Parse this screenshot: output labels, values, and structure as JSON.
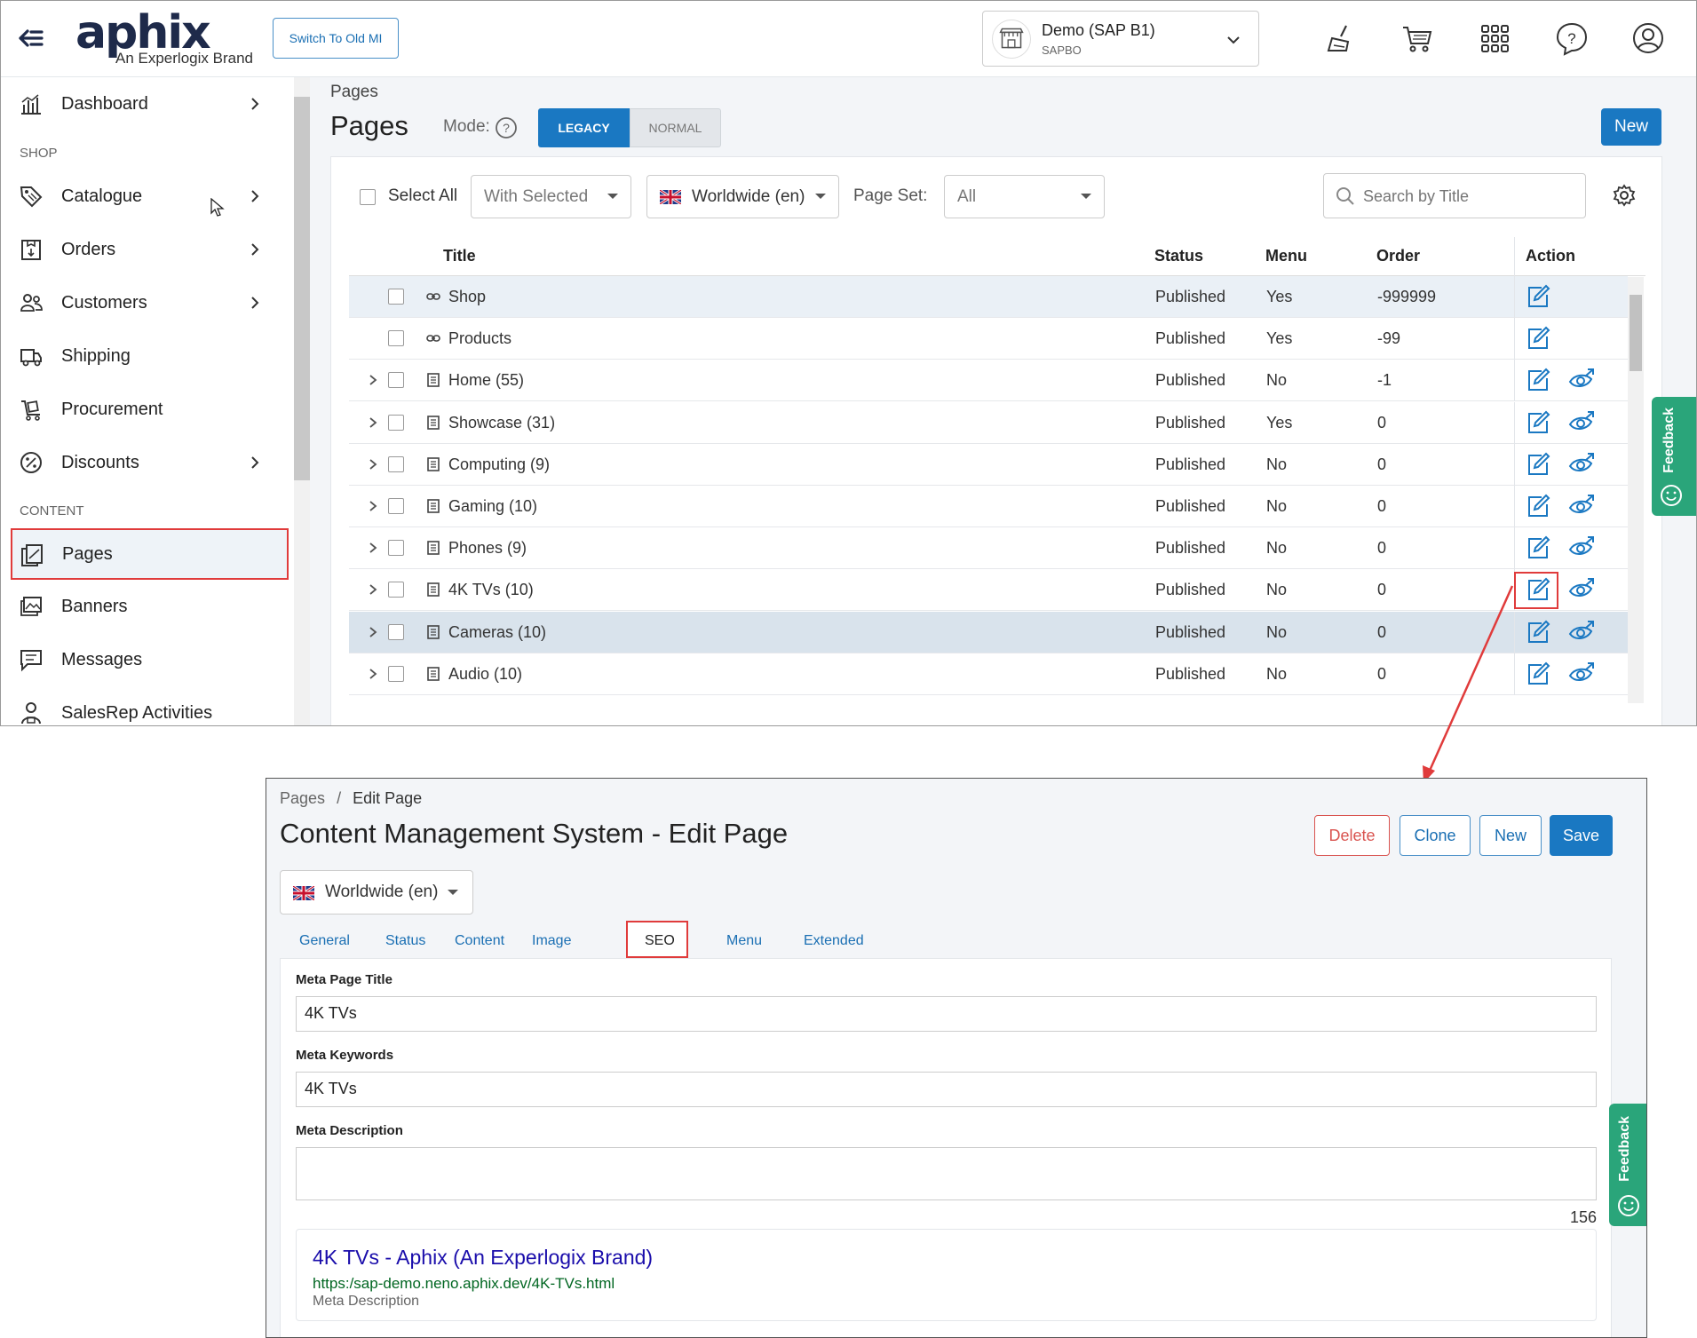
{
  "top": {
    "header": {
      "logo_text": "aphix",
      "logo_subtitle": "An Experlogix Brand",
      "switch_button": "Switch To Old MI",
      "company_name": "Demo (SAP B1)",
      "company_sub": "SAPBO",
      "icons": [
        "back-arrow-icon",
        "broom-icon",
        "cart-icon",
        "apps-grid-icon",
        "help-icon",
        "user-icon"
      ]
    },
    "sidebar": {
      "items": [
        {
          "label": "Dashboard",
          "icon": "dashboard-icon",
          "arrow": true
        },
        {
          "label": "Catalogue",
          "icon": "tag-icon",
          "arrow": true
        },
        {
          "label": "Orders",
          "icon": "orders-icon",
          "arrow": true
        },
        {
          "label": "Customers",
          "icon": "customers-icon",
          "arrow": true
        },
        {
          "label": "Shipping",
          "icon": "truck-icon",
          "arrow": false
        },
        {
          "label": "Procurement",
          "icon": "procurement-icon",
          "arrow": false
        },
        {
          "label": "Discounts",
          "icon": "discount-icon",
          "arrow": true
        },
        {
          "label": "Pages",
          "icon": "pages-icon",
          "arrow": false,
          "active": true
        },
        {
          "label": "Banners",
          "icon": "banners-icon",
          "arrow": false
        },
        {
          "label": "Messages",
          "icon": "messages-icon",
          "arrow": false
        },
        {
          "label": "SalesRep Activities",
          "icon": "salesrep-icon",
          "arrow": false
        }
      ],
      "sections": {
        "shop": "SHOP",
        "content": "CONTENT"
      }
    },
    "main": {
      "breadcrumb": "Pages",
      "title": "Pages",
      "mode_label": "Mode:",
      "mode_legacy": "LEGACY",
      "mode_normal": "NORMAL",
      "new_button": "New",
      "select_all": "Select All",
      "with_selected": "With Selected",
      "region": "Worldwide (en)",
      "page_set_label": "Page Set:",
      "page_set_value": "All",
      "search_placeholder": "Search by Title",
      "columns": {
        "title": "Title",
        "status": "Status",
        "menu": "Menu",
        "order": "Order",
        "action": "Action"
      },
      "rows": [
        {
          "title": "Shop",
          "status": "Published",
          "menu": "Yes",
          "order": "-999999",
          "type": "link",
          "expandable": false,
          "view": false
        },
        {
          "title": "Products",
          "status": "Published",
          "menu": "Yes",
          "order": "-99",
          "type": "link",
          "expandable": false,
          "view": false
        },
        {
          "title": "Home (55)",
          "status": "Published",
          "menu": "No",
          "order": "-1",
          "type": "page",
          "expandable": true,
          "view": true
        },
        {
          "title": "Showcase (31)",
          "status": "Published",
          "menu": "Yes",
          "order": "0",
          "type": "page",
          "expandable": true,
          "view": true
        },
        {
          "title": "Computing (9)",
          "status": "Published",
          "menu": "No",
          "order": "0",
          "type": "page",
          "expandable": true,
          "view": true
        },
        {
          "title": "Gaming (10)",
          "status": "Published",
          "menu": "No",
          "order": "0",
          "type": "page",
          "expandable": true,
          "view": true
        },
        {
          "title": "Phones (9)",
          "status": "Published",
          "menu": "No",
          "order": "0",
          "type": "page",
          "expandable": true,
          "view": true
        },
        {
          "title": "4K TVs (10)",
          "status": "Published",
          "menu": "No",
          "order": "0",
          "type": "page",
          "expandable": true,
          "view": true
        },
        {
          "title": "Cameras (10)",
          "status": "Published",
          "menu": "No",
          "order": "0",
          "type": "page",
          "expandable": true,
          "view": true
        },
        {
          "title": "Audio (10)",
          "status": "Published",
          "menu": "No",
          "order": "0",
          "type": "page",
          "expandable": true,
          "view": true
        }
      ]
    },
    "feedback_label": "Feedback"
  },
  "edit": {
    "breadcrumb_root": "Pages",
    "breadcrumb_sep": "/",
    "breadcrumb_current": "Edit Page",
    "title": "Content Management System - Edit Page",
    "buttons": {
      "delete": "Delete",
      "clone": "Clone",
      "new": "New",
      "save": "Save"
    },
    "region": "Worldwide (en)",
    "tabs": [
      "General",
      "Status",
      "Content",
      "Image",
      "SEO",
      "Menu",
      "Extended"
    ],
    "active_tab": "SEO",
    "fields": {
      "meta_title_label": "Meta Page Title",
      "meta_title_value": "4K TVs",
      "meta_keywords_label": "Meta Keywords",
      "meta_keywords_value": "4K TVs",
      "meta_description_label": "Meta Description",
      "meta_description_value": "",
      "char_counter": "156"
    },
    "preview": {
      "title": "4K TVs - Aphix (An Experlogix Brand)",
      "url": "https:/sap-demo.neno.aphix.dev/4K-TVs.html",
      "description": "Meta Description"
    },
    "feedback_label": "Feedback"
  },
  "colors": {
    "primary": "#1a78c2",
    "highlight_box": "#e03b3b",
    "feedback": "#2aa57a",
    "navy": "#1e2a4a"
  }
}
